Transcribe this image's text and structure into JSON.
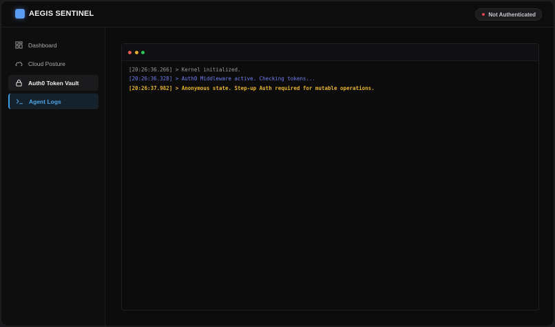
{
  "header": {
    "brand": "AEGIS SENTINEL",
    "auth_status": "Not Authenticated"
  },
  "sidebar": {
    "items": [
      {
        "label": "Dashboard",
        "icon": "dashboard-grid-icon"
      },
      {
        "label": "Cloud Posture",
        "icon": "cloud-icon"
      },
      {
        "label": "Auth0 Token Vault",
        "icon": "lock-icon"
      },
      {
        "label": "Agent Logs",
        "icon": "terminal-icon",
        "active": true
      }
    ]
  },
  "terminal": {
    "logs": [
      {
        "text": "[20:26:36.266] > Kernel initialized.",
        "level": "info"
      },
      {
        "text": "[20:26:36.328] > Auth0 Middleware active. Checking tokens...",
        "level": "system"
      },
      {
        "text": "[20:26:37.982] > Anonymous state. Step-up Auth required for mutable operations.",
        "level": "warning"
      }
    ]
  },
  "colors": {
    "accent": "#4ba7ea",
    "brand_mark": "#5b9bf1",
    "error_dot": "#e0434b",
    "warning_text": "#e9b52c",
    "system_text": "#6f7ff0",
    "window_close": "#ed5a55",
    "window_minimize": "#e7b031",
    "window_maximize": "#2ec457"
  }
}
